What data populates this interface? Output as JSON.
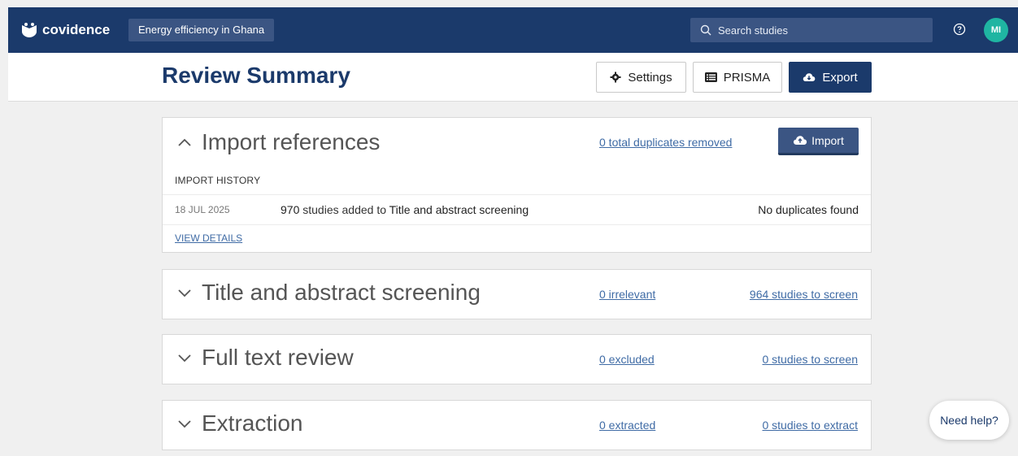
{
  "nav": {
    "logo_text": "covidence",
    "review_name": "Energy efficiency in Ghana",
    "search_placeholder": "Search studies",
    "avatar_initials": "MI"
  },
  "header": {
    "title": "Review Summary",
    "settings_label": "Settings",
    "prisma_label": "PRISMA",
    "export_label": "Export"
  },
  "import_card": {
    "title": "Import references",
    "duplicates_link": "0 total duplicates removed",
    "import_label": "Import",
    "history_label": "IMPORT HISTORY",
    "history": [
      {
        "date": "18 JUL 2025",
        "count": "970",
        "text_middle": " studies added to ",
        "destination": "Title and abstract screening",
        "status": "No duplicates found"
      }
    ],
    "view_details": "VIEW DETAILS"
  },
  "stage_cards": [
    {
      "title": "Title and abstract screening",
      "link_a": "0 irrelevant",
      "link_b": "964 studies to screen"
    },
    {
      "title": "Full text review",
      "link_a": "0 excluded",
      "link_b": "0 studies to screen"
    },
    {
      "title": "Extraction",
      "link_a": "0 extracted",
      "link_b": "0 studies to extract"
    }
  ],
  "help": {
    "label": "Need help?"
  },
  "colors": {
    "brand_navy": "#1b3a6b",
    "accent_teal": "#1fb5a2",
    "link_blue": "#3f6ba5"
  }
}
